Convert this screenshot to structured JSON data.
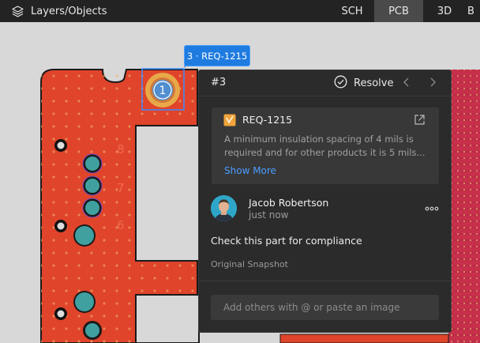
{
  "topbar": {
    "layers_label": "Layers/Objects",
    "tabs": [
      {
        "label": "SCH",
        "active": false
      },
      {
        "label": "PCB",
        "active": true
      },
      {
        "label": "3D",
        "active": false
      },
      {
        "label": "B",
        "active": false
      }
    ]
  },
  "canvas": {
    "pin_marker_number": "1",
    "tag_label": "3 · REQ-1215",
    "silk_digits": [
      "8",
      "7",
      "6"
    ]
  },
  "comment": {
    "thread_number": "#3",
    "resolve_label": "Resolve",
    "requirement": {
      "id": "REQ-1215",
      "description": "A minimum insulation spacing of 4 mils is required and for other products it is 5 mils...",
      "show_more": "Show More"
    },
    "author": "Jacob Robertson",
    "time": "just now",
    "message": "Check this part for compliance",
    "snapshot_label": "Original Snapshot",
    "reply_placeholder": "Add others with @ or paste an image"
  },
  "colors": {
    "board": "#e0442a",
    "accent": "#1e7be0",
    "link": "#4b9dff",
    "requirement_icon": "#f0a43a",
    "panel": "#2b2b2b"
  },
  "icons": {
    "layers": "layers-icon",
    "resolve": "check-circle-icon",
    "prev": "chevron-left-icon",
    "next": "chevron-right-icon",
    "requirement": "requirement-icon",
    "external": "external-link-icon",
    "more": "more-horizontal-icon"
  }
}
